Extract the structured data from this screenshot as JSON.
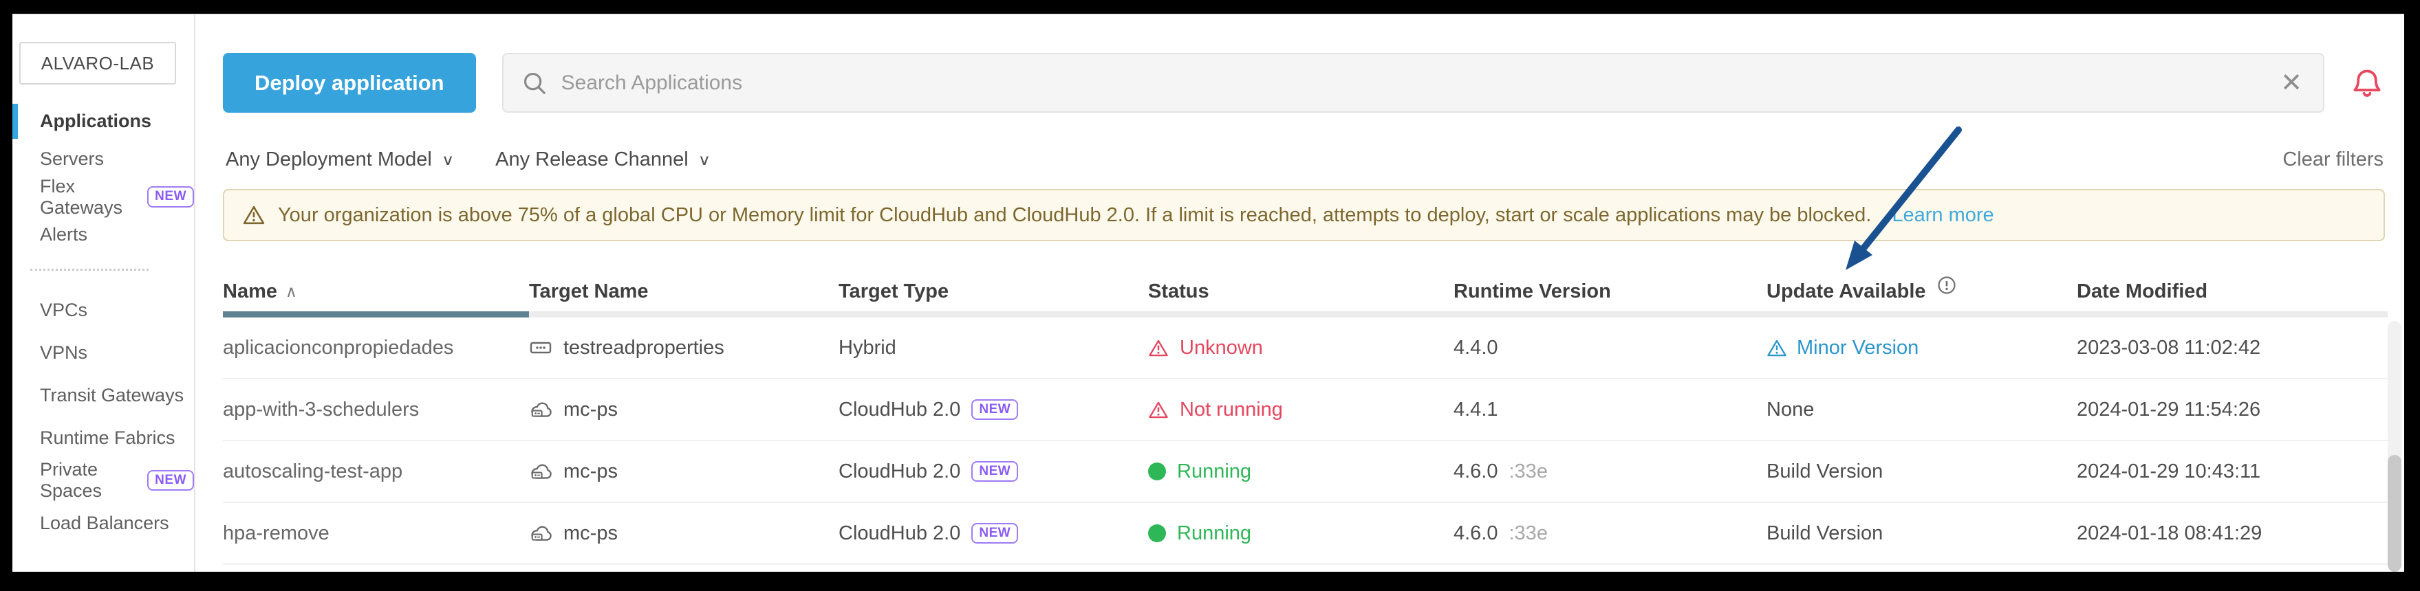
{
  "window": {
    "env_label": "ALVARO-LAB"
  },
  "sidebar": {
    "items_top": [
      {
        "label": "Applications"
      },
      {
        "label": "Servers"
      },
      {
        "label": "Flex Gateways",
        "badge": "NEW"
      },
      {
        "label": "Alerts"
      }
    ],
    "items_bottom": [
      {
        "label": "VPCs"
      },
      {
        "label": "VPNs"
      },
      {
        "label": "Transit Gateways"
      },
      {
        "label": "Runtime Fabrics"
      },
      {
        "label": "Private Spaces",
        "badge": "NEW"
      },
      {
        "label": "Load Balancers"
      }
    ]
  },
  "toolbar": {
    "deploy_label": "Deploy application",
    "search_placeholder": "Search Applications",
    "clear_glyph": "✕"
  },
  "filters": {
    "deployment_model": "Any Deployment Model",
    "release_channel": "Any Release Channel",
    "chevron_glyph": "∨",
    "clear_label": "Clear filters"
  },
  "banner": {
    "message": "Your organization is above 75% of a global CPU or Memory limit for CloudHub and CloudHub 2.0. If a limit is reached, attempts to deploy, start or scale applications may be blocked.",
    "link_label": "Learn more"
  },
  "table": {
    "sort_glyph": "∧",
    "headers": {
      "name": "Name",
      "target_name": "Target Name",
      "target_type": "Target Type",
      "status": "Status",
      "runtime_version": "Runtime Version",
      "update_available": "Update Available",
      "date_modified": "Date Modified"
    },
    "rows": [
      {
        "name": "aplicacionconpropiedades",
        "target": "testreadproperties",
        "target_icon": "server",
        "type": "Hybrid",
        "status": "Unknown",
        "status_kind": "error",
        "runtime": "4.4.0",
        "runtime_suffix": "",
        "update": "Minor Version",
        "update_kind": "link",
        "date": "2023-03-08 11:02:42"
      },
      {
        "name": "app-with-3-schedulers",
        "target": "mc-ps",
        "target_icon": "private-space-cloud",
        "type": "CloudHub 2.0",
        "type_badge": "NEW",
        "status": "Not running",
        "status_kind": "error",
        "runtime": "4.4.1",
        "runtime_suffix": "",
        "update": "None",
        "update_kind": "text",
        "date": "2024-01-29 11:54:26"
      },
      {
        "name": "autoscaling-test-app",
        "target": "mc-ps",
        "target_icon": "private-space-cloud",
        "type": "CloudHub 2.0",
        "type_badge": "NEW",
        "status": "Running",
        "status_kind": "ok",
        "runtime": "4.6.0",
        "runtime_suffix": ":33e",
        "update": "Build Version",
        "update_kind": "text",
        "date": "2024-01-29 10:43:11"
      },
      {
        "name": "hpa-remove",
        "target": "mc-ps",
        "target_icon": "private-space-cloud",
        "type": "CloudHub 2.0",
        "type_badge": "NEW",
        "status": "Running",
        "status_kind": "ok",
        "runtime": "4.6.0",
        "runtime_suffix": ":33e",
        "update": "Build Version",
        "update_kind": "text",
        "date": "2024-01-18 08:41:29"
      }
    ]
  },
  "colors": {
    "accent_blue": "#36a3dd",
    "link_blue": "#2b96cd",
    "error_red": "#e4475f",
    "success_green": "#2eb757",
    "badge_purple": "#8a5cf6",
    "warning_text": "#7d672e",
    "warning_bg": "#fdf9ec",
    "bell_red": "#e8485f",
    "sort_underline": "#5f8191",
    "arrow_navy": "#1a5190"
  },
  "icons": {
    "search": "magnifier",
    "clear": "x-mark",
    "bell": "notification-bell",
    "warning": "triangle-exclamation",
    "info": "circle-exclamation",
    "running": "filled-circle",
    "server": "server-outline",
    "private_space": "cloud-server-outline",
    "annotation": "navy-arrow"
  }
}
